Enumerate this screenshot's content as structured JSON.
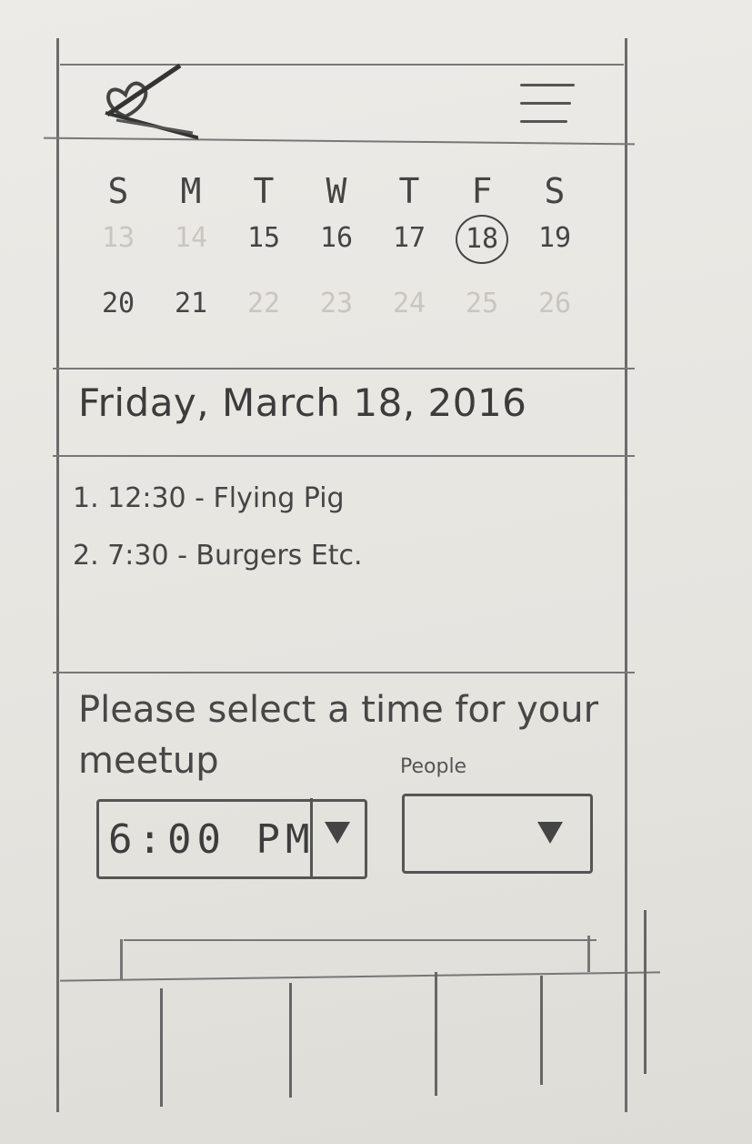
{
  "header": {
    "logo_icon": "crossed-out-heart-logo",
    "menu_icon": "hamburger-menu-icon"
  },
  "calendar": {
    "weekdays": [
      "S",
      "M",
      "T",
      "W",
      "T",
      "F",
      "S"
    ],
    "week1": [
      "13",
      "14",
      "15",
      "16",
      "17",
      "18",
      "19"
    ],
    "week2": [
      "20",
      "21",
      "22",
      "23",
      "24",
      "25",
      "26"
    ],
    "selected_day": "18"
  },
  "selected_date_label": "Friday, March 18, 2016",
  "events": [
    {
      "label": "1. 12:30 - Flying Pig"
    },
    {
      "label": "2. 7:30 - Burgers Etc."
    }
  ],
  "meetup": {
    "prompt": "Please select a time for your meetup",
    "people_label": "People",
    "time_value": "6:00 PM",
    "people_value": ""
  },
  "tabs": [
    "",
    "",
    "",
    "",
    ""
  ]
}
